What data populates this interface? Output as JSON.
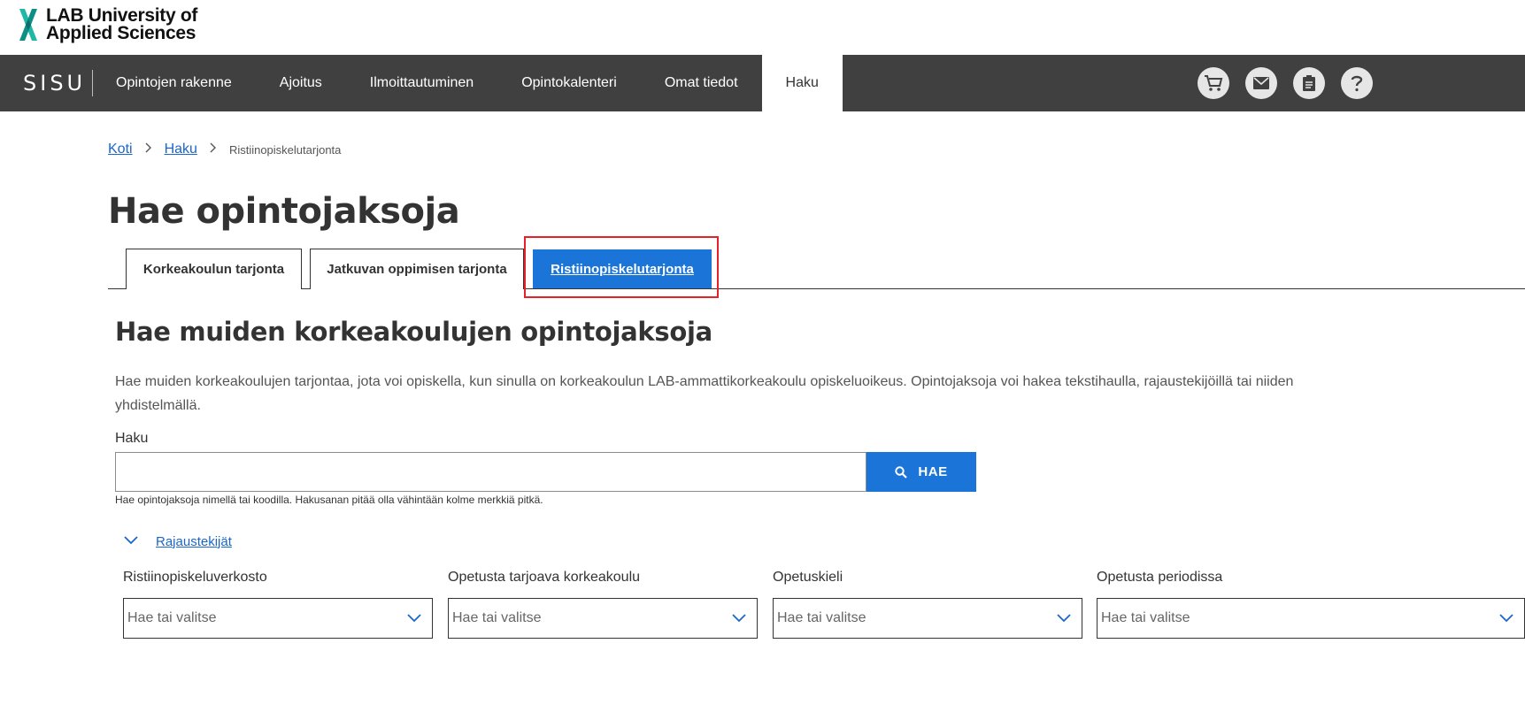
{
  "logo": {
    "line1": "LAB University of",
    "line2": "Applied Sciences"
  },
  "topnav": {
    "brand": "SISU",
    "items": [
      {
        "label": "Opintojen rakenne"
      },
      {
        "label": "Ajoitus"
      },
      {
        "label": "Ilmoittautuminen"
      },
      {
        "label": "Opintokalenteri"
      },
      {
        "label": "Omat tiedot"
      },
      {
        "label": "Haku",
        "active": true
      }
    ],
    "icons": [
      "cart-icon",
      "mail-icon",
      "notes-icon",
      "help-icon"
    ]
  },
  "breadcrumb": {
    "home": "Koti",
    "search": "Haku",
    "current": "Ristiinopiskelutarjonta"
  },
  "page": {
    "title": "Hae opintojaksoja"
  },
  "tabs": [
    {
      "label": "Korkeakoulun tarjonta"
    },
    {
      "label": "Jatkuvan oppimisen tarjonta"
    },
    {
      "label": "Ristiinopiskelutarjonta",
      "active": true
    }
  ],
  "section": {
    "title": "Hae muiden korkeakoulujen opintojaksoja",
    "description": "Hae muiden korkeakoulujen tarjontaa, jota voi opiskella, kun sinulla on korkeakoulun LAB-ammattikorkeakoulu opiskeluoikeus. Opintojaksoja voi hakea tekstihaulla, rajaustekijöillä tai niiden yhdistelmällä."
  },
  "search": {
    "label": "Haku",
    "value": "",
    "button_label": "HAE",
    "help": "Hae opintojaksoja nimellä tai koodilla. Hakusanan pitää olla vähintään kolme merkkiä pitkä."
  },
  "filters": {
    "toggle_label": "Rajaustekijät",
    "items": [
      {
        "label": "Ristiinopiskeluverkosto",
        "placeholder": "Hae tai valitse"
      },
      {
        "label": "Opetusta tarjoava korkeakoulu",
        "placeholder": "Hae tai valitse"
      },
      {
        "label": "Opetuskieli",
        "placeholder": "Hae tai valitse"
      },
      {
        "label": "Opetusta periodissa",
        "placeholder": "Hae tai valitse"
      }
    ]
  },
  "colors": {
    "nav_bg": "#404040",
    "accent": "#1b75d9",
    "highlight": "#e8202a",
    "logo_green": "#1fb7a6"
  }
}
